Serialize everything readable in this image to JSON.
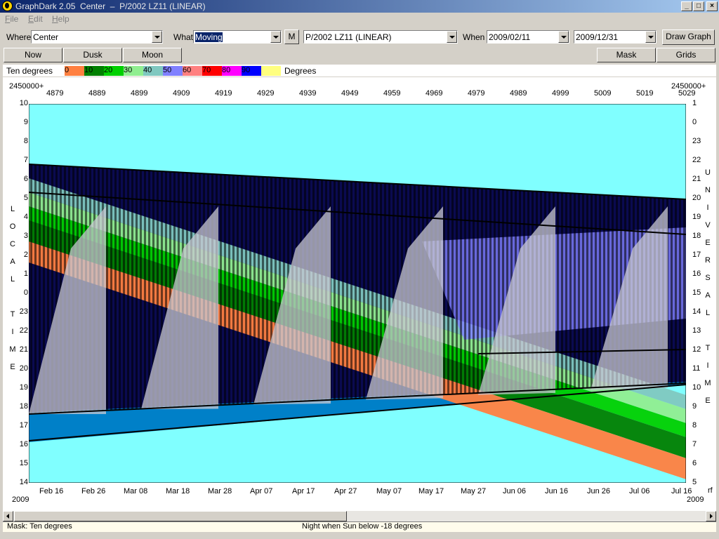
{
  "window": {
    "title": "GraphDark 2.05  Center  –  P/2002 LZ11 (LINEAR)",
    "min": "_",
    "max": "□",
    "close": "×"
  },
  "menu": [
    {
      "label": "File",
      "key": "F"
    },
    {
      "label": "Edit",
      "key": "E"
    },
    {
      "label": "Help",
      "key": "H"
    }
  ],
  "toolbar": {
    "where_label": "Where",
    "where_value": "Center",
    "what_label": "What",
    "what_value": "Moving",
    "m_button": "M",
    "object_value": "P/2002 LZ11 (LINEAR)",
    "when_label": "When",
    "start_date": "2009/02/11",
    "end_date": "2009/12/31",
    "draw_button": "Draw Graph"
  },
  "buttons": {
    "now": "Now",
    "dusk": "Dusk",
    "moon": "Moon",
    "mask": "Mask",
    "grids": "Grids"
  },
  "legend": {
    "title": "Ten degrees",
    "unit": "Degrees",
    "items": [
      {
        "label": "0",
        "color": "#ff8040"
      },
      {
        "label": "10",
        "color": "#008000"
      },
      {
        "label": "20",
        "color": "#00d000"
      },
      {
        "label": "30",
        "color": "#90ee90"
      },
      {
        "label": "40",
        "color": "#80c8c0"
      },
      {
        "label": "50",
        "color": "#8080ff"
      },
      {
        "label": "60",
        "color": "#ff8080"
      },
      {
        "label": "70",
        "color": "#ff0000"
      },
      {
        "label": "80",
        "color": "#ff00ff"
      },
      {
        "label": "90",
        "color": "#0000ff"
      },
      {
        "label": "",
        "color": "#ffff80"
      }
    ]
  },
  "plot": {
    "jd_prefix_left": "2450000+",
    "jd_prefix_right": "2450000+",
    "jd_ticks": [
      "4879",
      "4889",
      "4899",
      "4909",
      "4919",
      "4929",
      "4939",
      "4949",
      "4959",
      "4969",
      "4979",
      "4989",
      "4999",
      "5009",
      "5019",
      "5029"
    ],
    "date_ticks": [
      "Feb 16",
      "Feb 26",
      "Mar 08",
      "Mar 18",
      "Mar 28",
      "Apr 07",
      "Apr 17",
      "Apr 27",
      "May 07",
      "May 17",
      "May 27",
      "Jun 06",
      "Jun 16",
      "Jun 26",
      "Jul 06",
      "Jul 16"
    ],
    "year_left": "2009",
    "year_right": "2009",
    "corner_right": "rf",
    "local_time_ticks": [
      "10",
      "9",
      "8",
      "7",
      "6",
      "5",
      "4",
      "3",
      "2",
      "1",
      "0",
      "23",
      "22",
      "21",
      "20",
      "19",
      "18",
      "17",
      "16",
      "15",
      "14"
    ],
    "ut_ticks": [
      "1",
      "0",
      "23",
      "22",
      "21",
      "20",
      "19",
      "18",
      "17",
      "16",
      "15",
      "14",
      "13",
      "12",
      "11",
      "10",
      "9",
      "8",
      "7",
      "6",
      "5"
    ],
    "left_axis_title": "LOCAL TIME",
    "right_axis_title": "UNIVERSAL TIME",
    "colors": {
      "day": "#80ffff",
      "night": "#0a0a50",
      "twilight": "#0080c8",
      "moon": "#c8c8d2"
    }
  },
  "status": {
    "mask": "Mask:  Ten degrees",
    "night": "Night when Sun below -18 degrees"
  }
}
